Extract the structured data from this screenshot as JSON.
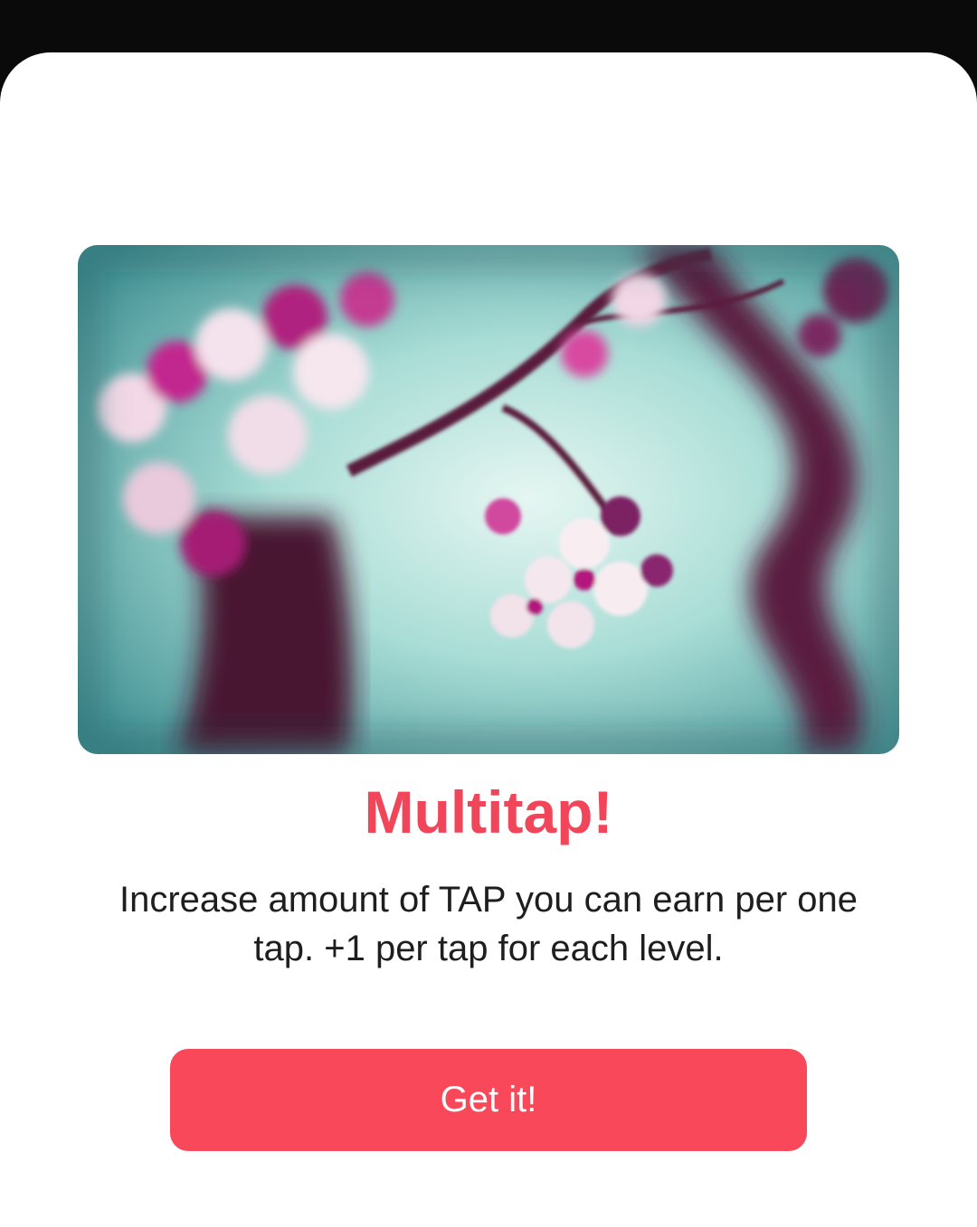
{
  "modal": {
    "title": "Multitap!",
    "description": "Increase amount of TAP you can earn per one tap. +1 per tap for each level.",
    "button_label": "Get it!"
  },
  "colors": {
    "accent": "#f1455a",
    "button": "#f9485a",
    "background_overlay": "#0a0a0a",
    "sheet": "#ffffff"
  },
  "image": {
    "subject": "cherry-blossom-photo"
  }
}
